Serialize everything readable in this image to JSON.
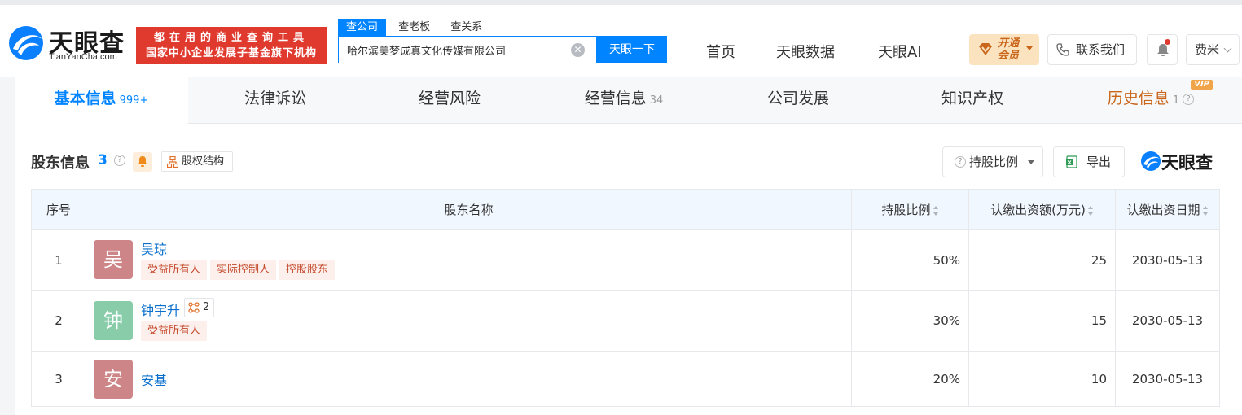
{
  "header": {
    "logo_text": "天眼查",
    "logo_sub": "TianYanCha.com",
    "slogan_line1": "都在用的商业查询工具",
    "slogan_line2": "国家中小企业发展子基金旗下机构",
    "search_tabs": [
      "查公司",
      "查老板",
      "查关系"
    ],
    "search_value": "哈尔滨美梦成真文化传媒有限公司",
    "search_button": "天眼一下",
    "nav": [
      "首页",
      "天眼数据",
      "天眼AI"
    ],
    "vip_line1": "开通",
    "vip_line2": "会员",
    "contact_label": "联系我们",
    "user_name": "费米"
  },
  "tabs": [
    {
      "label": "基本信息",
      "count": "999+"
    },
    {
      "label": "法律诉讼",
      "count": ""
    },
    {
      "label": "经营风险",
      "count": ""
    },
    {
      "label": "经营信息",
      "count": "34"
    },
    {
      "label": "公司发展",
      "count": ""
    },
    {
      "label": "知识产权",
      "count": ""
    },
    {
      "label": "历史信息",
      "count": "1",
      "badge": "VIP"
    }
  ],
  "section": {
    "title": "股东信息",
    "count": "3",
    "equity_label": "股权结构",
    "ratio_label": "持股比例",
    "export_label": "导出",
    "brand_text": "天眼查"
  },
  "table": {
    "headers": [
      "序号",
      "股东名称",
      "持股比例",
      "认缴出资额(万元)",
      "认缴出资日期"
    ],
    "rows": [
      {
        "index": "1",
        "avatar": "吴",
        "avatar_color": "#cd8587",
        "name": "吴琼",
        "tags": [
          "受益所有人",
          "实际控制人",
          "控股股东"
        ],
        "relations": "",
        "ratio": "50%",
        "amount": "25",
        "date": "2030-05-13"
      },
      {
        "index": "2",
        "avatar": "钟",
        "avatar_color": "#88ccaa",
        "name": "钟宇升",
        "tags": [
          "受益所有人"
        ],
        "relations": "2",
        "ratio": "30%",
        "amount": "15",
        "date": "2030-05-13"
      },
      {
        "index": "3",
        "avatar": "安",
        "avatar_color": "#cd8587",
        "name": "安基",
        "tags": [],
        "relations": "",
        "ratio": "20%",
        "amount": "10",
        "date": "2030-05-13"
      }
    ]
  },
  "colors": {
    "accent": "#0084ff",
    "brand_red": "#e03a2f",
    "tag_red": "#c4472a",
    "vip_gold": "#c9661b"
  },
  "icons": [
    "tianyancha-logo-icon",
    "clear-icon",
    "diamond-icon",
    "phone-icon",
    "bell-icon",
    "question-icon",
    "alert-bell-icon",
    "equity-structure-icon",
    "excel-icon",
    "relation-icon",
    "sort-icon"
  ]
}
